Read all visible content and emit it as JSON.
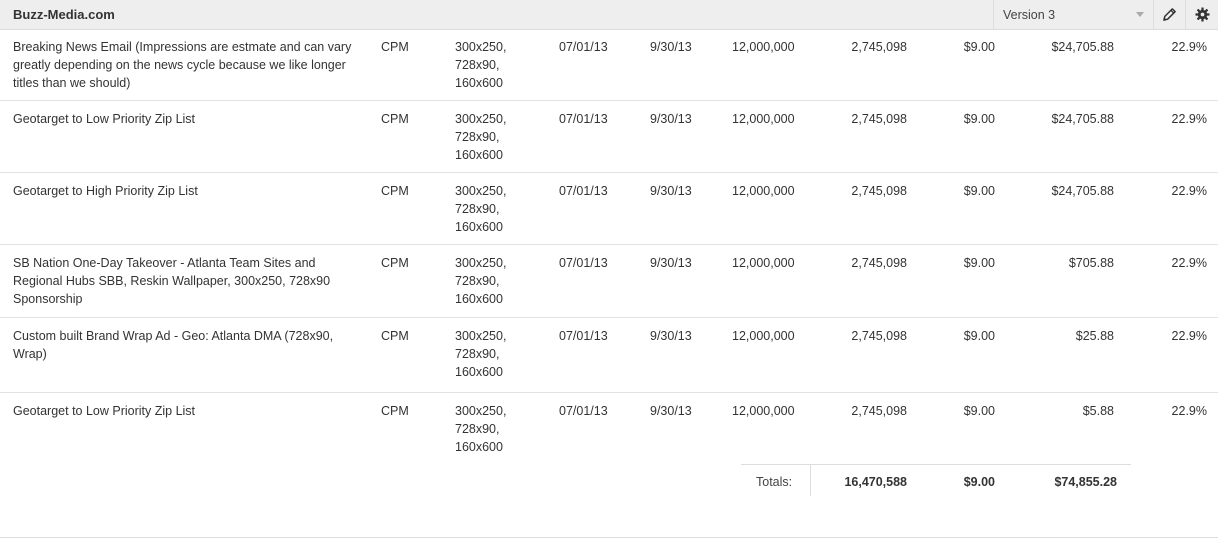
{
  "header": {
    "site": "Buzz-Media.com",
    "version_label": "Version 3"
  },
  "rows": [
    {
      "name": "Breaking News Email (Impressions are estmate and can vary  greatly depending on the news cycle because we like longer titles than we should)",
      "type": "CPM",
      "sizes": "300x250, 728x90, 160x600",
      "start": "07/01/13",
      "end": "9/30/13",
      "impressions": "12,000,000",
      "delivered": "2,745,098",
      "rate": "$9.00",
      "cost": "$24,705.88",
      "pct": "22.9%"
    },
    {
      "name": "Geotarget to Low Priority Zip List",
      "type": "CPM",
      "sizes": "300x250, 728x90, 160x600",
      "start": "07/01/13",
      "end": "9/30/13",
      "impressions": "12,000,000",
      "delivered": "2,745,098",
      "rate": "$9.00",
      "cost": "$24,705.88",
      "pct": "22.9%"
    },
    {
      "name": "Geotarget to High Priority Zip List",
      "type": "CPM",
      "sizes": "300x250, 728x90, 160x600",
      "start": "07/01/13",
      "end": "9/30/13",
      "impressions": "12,000,000",
      "delivered": "2,745,098",
      "rate": "$9.00",
      "cost": "$24,705.88",
      "pct": "22.9%"
    },
    {
      "name": "SB Nation One-Day Takeover - Atlanta Team Sites and Regional Hubs SBB, Reskin Wallpaper, 300x250, 728x90 Sponsorship",
      "type": "CPM",
      "sizes": "300x250, 728x90, 160x600",
      "start": "07/01/13",
      "end": "9/30/13",
      "impressions": "12,000,000",
      "delivered": "2,745,098",
      "rate": "$9.00",
      "cost": "$705.88",
      "pct": "22.9%"
    },
    {
      "name": "Custom built Brand Wrap Ad - Geo: Atlanta DMA (728x90, Wrap)",
      "type": "CPM",
      "sizes": "300x250, 728x90, 160x600",
      "start": "07/01/13",
      "end": "9/30/13",
      "impressions": "12,000,000",
      "delivered": "2,745,098",
      "rate": "$9.00",
      "cost": "$25.88",
      "pct": "22.9%"
    },
    {
      "name": "Geotarget to Low Priority Zip List",
      "type": "CPM",
      "sizes": "300x250, 728x90, 160x600",
      "start": "07/01/13",
      "end": "9/30/13",
      "impressions": "12,000,000",
      "delivered": "2,745,098",
      "rate": "$9.00",
      "cost": "$5.88",
      "pct": "22.9%"
    }
  ],
  "totals": {
    "label": "Totals:",
    "impressions": "16,470,588",
    "rate": "$9.00",
    "cost": "$74,855.28"
  }
}
